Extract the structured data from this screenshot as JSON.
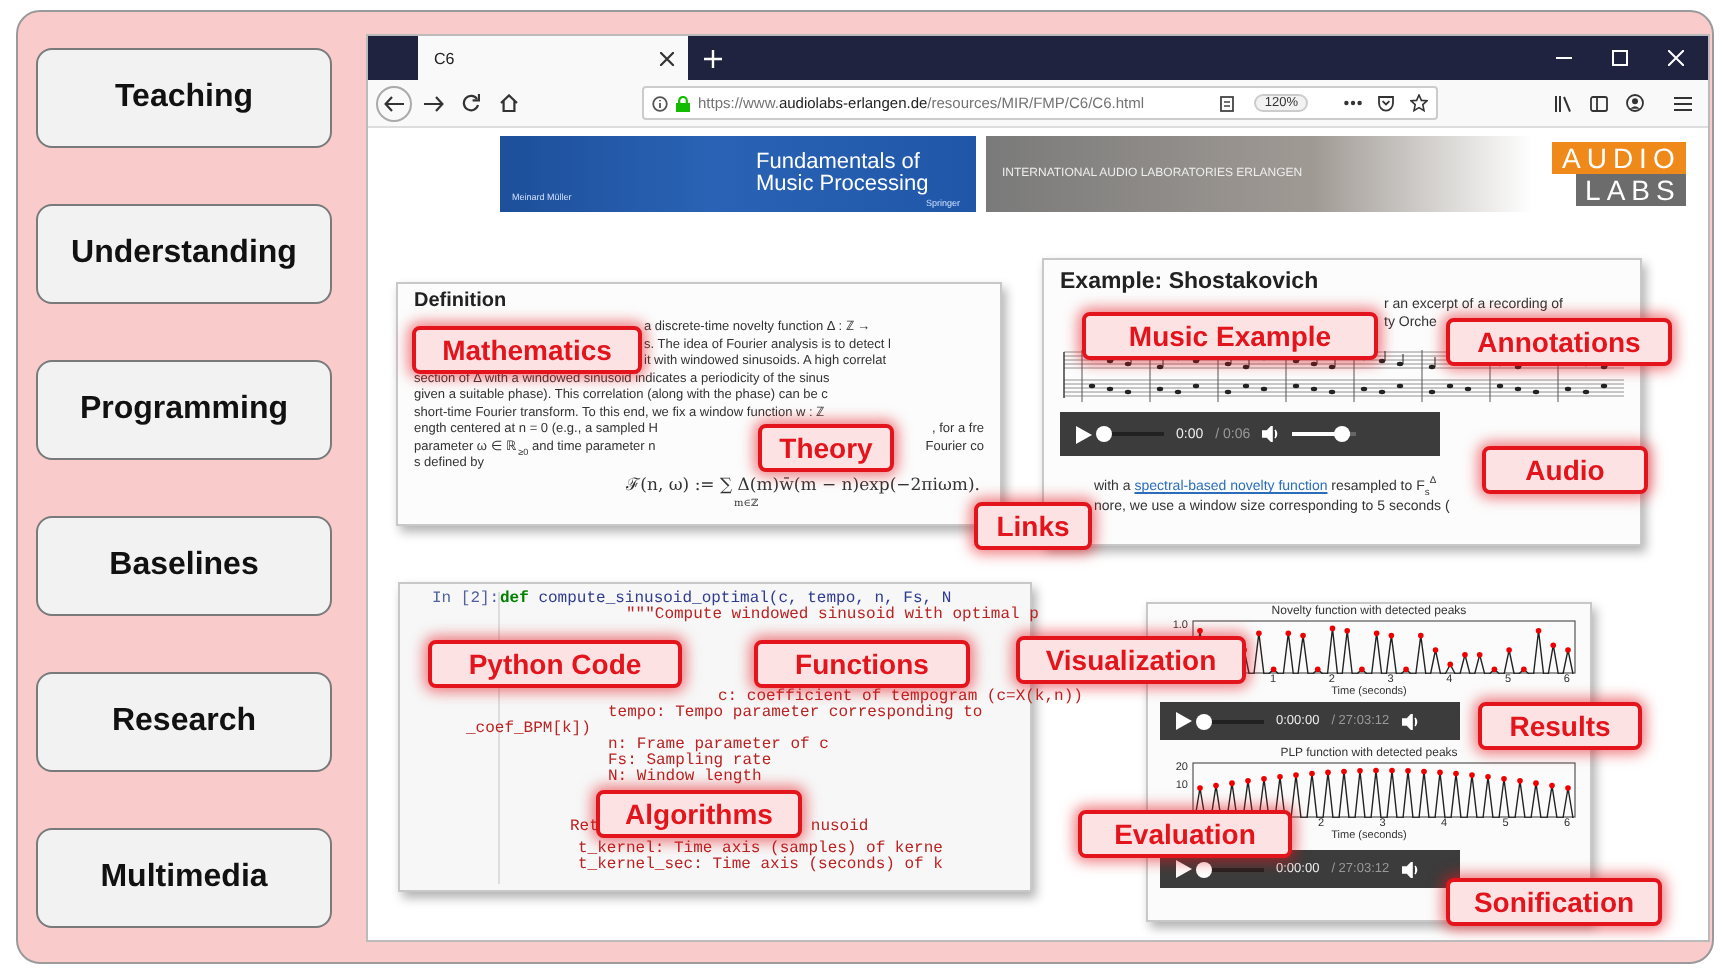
{
  "sidebar": {
    "items": [
      {
        "label": "Teaching"
      },
      {
        "label": "Understanding"
      },
      {
        "label": "Programming"
      },
      {
        "label": "Baselines"
      },
      {
        "label": "Research"
      },
      {
        "label": "Multimedia"
      }
    ]
  },
  "browser": {
    "tab": {
      "title": "C6"
    },
    "address": {
      "prefix": "https://www.",
      "domain": "audiolabs-erlangen.de",
      "path": "/resources/MIR/FMP/C6/C6.html"
    },
    "zoom": "120%"
  },
  "banner": {
    "book_title": "Fundamentals of Music Processing",
    "author": "Meinard Müller",
    "publisher": "Springer",
    "institute": "INTERNATIONAL AUDIO LABORATORIES ERLANGEN",
    "logo_top": "AUDIO",
    "logo_bottom": "LABS"
  },
  "definition": {
    "heading": "Definition",
    "lines": [
      {
        "parts": [
          "a discrete-time novelty function Δ : ℤ →"
        ]
      },
      {
        "parts": [
          "s. The idea of Fourier analysis is to detect l"
        ]
      },
      {
        "parts": [
          "it with windowed sinusoids. A high correlat"
        ]
      },
      {
        "parts": [
          "section of Δ with a windowed sinusoid indicates a periodicity of the sinus"
        ]
      },
      {
        "parts": [
          "given a suitable phase). This correlation (along with the phase) can be c"
        ]
      },
      {
        "parts": [
          "short-time Fourier transform. To this end, we fix a window function w : ℤ"
        ]
      },
      {
        "parts": [
          "ength centered at n = 0 (e.g., a sampled H",
          ", for a fre"
        ]
      },
      {
        "parts": [
          "parameter ω ∈ ℝ$_{≥0}$ and time parameter n",
          "Fourier co"
        ]
      },
      {
        "parts": [
          "s defined by"
        ]
      }
    ],
    "formula": "ℱ(n, ω) := ∑ Δ(m)w̄(m − n)exp(−2πiωm).",
    "formula_index": "m∈ℤ"
  },
  "example": {
    "heading": "Example: Shostakovich",
    "lines": [
      "r an excerpt of a recording of",
      "ty Orche"
    ],
    "player": {
      "current": "0:00",
      "duration": "/ 0:06",
      "progress": {
        "level": 0
      },
      "volume": {
        "level": 0.9
      }
    },
    "link_line": {
      "before": "with a ",
      "link": "spectral-based novelty function",
      "after": " resampled to F$_{s}$$^{Δ}$"
    },
    "last_line": "nore, we use a window size corresponding to 5 seconds ("
  },
  "code": {
    "prompt": "In [2]:",
    "lines": [
      {
        "parts": [
          "**def** compute_sinusoid_optimal(c, tempo, n, Fs, N"
        ]
      },
      {
        "parts": [
          "\"\"\"Compute windowed sinusoid with optimal p"
        ]
      },
      {
        "parts": [
          "c: coefficient of tempogram (c=X(k,n))"
        ]
      },
      {
        "parts": [
          "tempo: Tempo parameter corresponding to"
        ]
      },
      {
        "parts": [
          "_coef_BPM[k])"
        ]
      },
      {
        "parts": [
          "n: Frame parameter of c"
        ]
      },
      {
        "parts": [
          "Fs: Sampling rate"
        ]
      },
      {
        "parts": [
          "N: Window length"
        ]
      },
      {
        "parts": [
          "Ret",
          "nusoid"
        ]
      },
      {
        "parts": [
          "t_kernel: Time axis (samples) of kerne"
        ]
      },
      {
        "parts": [
          "t_kernel_sec: Time axis (seconds) of k"
        ]
      }
    ]
  },
  "plots": [
    {
      "title": "Novelty function with detected peaks",
      "yticks": [
        "1.0"
      ],
      "xticks": [
        "1",
        "2",
        "3",
        "4",
        "5",
        "6"
      ],
      "xlabel": "Time (seconds)",
      "player": {
        "current": "0:00:00",
        "duration": "/ 27:03:12",
        "progress": {
          "level": 0
        }
      }
    },
    {
      "title": "PLP function with detected peaks",
      "yticks": [
        "20",
        "10"
      ],
      "xticks": [
        "2",
        "3",
        "4",
        "5",
        "6"
      ],
      "xlabel": "Time (seconds)",
      "player": {
        "current": "0:00:00",
        "duration": "/ 27:03:12",
        "progress": {
          "level": 0
        }
      }
    }
  ],
  "callouts": [
    {
      "text": "Mathematics"
    },
    {
      "text": "Music Example"
    },
    {
      "text": "Annotations"
    },
    {
      "text": "Theory"
    },
    {
      "text": "Audio"
    },
    {
      "text": "Links"
    },
    {
      "text": "Python Code"
    },
    {
      "text": "Functions"
    },
    {
      "text": "Visualization"
    },
    {
      "text": "Results"
    },
    {
      "text": "Algorithms"
    },
    {
      "text": "Evaluation"
    },
    {
      "text": "Sonification"
    }
  ]
}
